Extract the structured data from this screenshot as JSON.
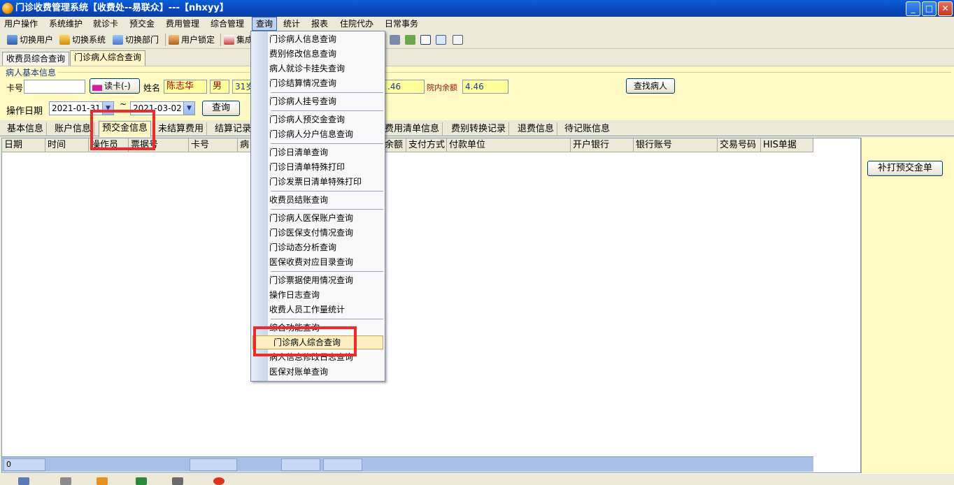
{
  "window": {
    "title": "门诊收费管理系统【收费处--易联众】---【nhxyy】",
    "min": "_",
    "max": "□",
    "close": "✕"
  },
  "menubar": [
    "用户操作",
    "系统维护",
    "就诊卡",
    "预交金",
    "费用管理",
    "综合管理",
    "查询",
    "统计",
    "报表",
    "住院代办",
    "日常事务"
  ],
  "toolbar": {
    "switch_user": "切换用户",
    "switch_system": "切换系统",
    "switch_dept": "切换部门",
    "user_lock": "用户锁定",
    "collect": "集成"
  },
  "doc_tabs": [
    "收费员综合查询",
    "门诊病人综合查询"
  ],
  "patient_info": {
    "group_title": "病人基本信息",
    "card_label": "卡号",
    "card_value": "",
    "read_card_button": "读卡(-)",
    "name_label": "姓名",
    "name_value": "陈志华",
    "gender_value": "男",
    "age_value": "31岁",
    "balance_partial": ".46",
    "hosp_balance_label": "院内余额",
    "hosp_balance_value": "4.46",
    "find_patient_button": "查找病人"
  },
  "date_filter": {
    "label": "操作日期",
    "start": "2021-01-31",
    "sep": "~",
    "end": "2021-03-02",
    "query_button": "查询"
  },
  "sub_tabs": [
    "基本信息",
    "账户信息",
    "预交金信息",
    "未结算费用",
    "结算记录",
    "",
    "费用清单信息",
    "费别转换记录",
    "退费信息",
    "待记账信息"
  ],
  "grid_columns": [
    "日期",
    "时间",
    "操作员",
    "票据号",
    "卡号",
    "病",
    "",
    "",
    "余额",
    "支付方式",
    "付款单位",
    "开户银行",
    "银行账号",
    "交易号码",
    "HIS单据"
  ],
  "grid_footer": {
    "count": "0"
  },
  "right_panel": {
    "reprint_button": "补打预交金单"
  },
  "query_menu": {
    "groups": [
      [
        "门诊病人信息查询",
        "费别修改信息查询",
        "病人就诊卡挂失查询",
        "门诊结算情况查询"
      ],
      [
        "门诊病人挂号查询"
      ],
      [
        "门诊病人预交金查询",
        "门诊病人分户信息查询"
      ],
      [
        "门诊日清单查询",
        "门诊日清单特殊打印",
        "门诊发票日清单特殊打印"
      ],
      [
        "收费员结账查询"
      ],
      [
        "门诊病人医保账户查询",
        "门诊医保支付情况查询",
        "门诊动态分析查询",
        "医保收费对应目录查询"
      ],
      [
        "门诊票据使用情况查询",
        "操作日志查询",
        "收费人员工作量统计"
      ],
      [
        "综合功能查询",
        "门诊病人综合查询",
        "病人信息修改日志查询",
        "医保对账单查询"
      ]
    ]
  },
  "colors": {
    "title_bar": "#0a5fd8",
    "panel_yellow": "#fff9c4",
    "highlight_red": "#ee2b2b",
    "menu_highlight": "#ffeec2"
  }
}
